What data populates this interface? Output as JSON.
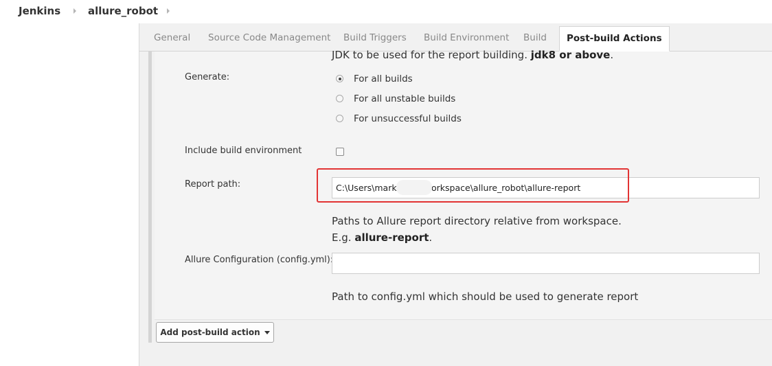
{
  "breadcrumb": {
    "items": [
      "Jenkins",
      "allure_robot"
    ]
  },
  "tabs": [
    {
      "label": "General",
      "active": false
    },
    {
      "label": "Source Code Management",
      "active": false
    },
    {
      "label": "Build Triggers",
      "active": false
    },
    {
      "label": "Build Environment",
      "active": false
    },
    {
      "label": "Build",
      "active": false
    },
    {
      "label": "Post-build Actions",
      "active": true
    }
  ],
  "form": {
    "jdk_help_prefix": "JDK to be used for the report building.",
    "jdk_help_bold": "jdk8 or above",
    "jdk_help_suffix": ".",
    "generate_label": "Generate:",
    "generate_options": [
      {
        "label": "For all builds",
        "checked": true
      },
      {
        "label": "For all unstable builds",
        "checked": false
      },
      {
        "label": "For unsuccessful builds",
        "checked": false
      }
    ],
    "include_env_label": "Include build environment",
    "include_env_checked": false,
    "report_path_label": "Report path:",
    "report_path_value": "C:\\Users\\mark\\        \\workspace\\allure_robot\\allure-report",
    "report_path_help_line1": "Paths to Allure report directory relative from workspace.",
    "report_path_help_prefix": "E.g.",
    "report_path_help_bold": "allure-report",
    "report_path_help_suffix": ".",
    "config_label": "Allure Configuration (config.yml):",
    "config_value": "",
    "config_help": "Path to config.yml which should be used to generate report"
  },
  "add_action_button": "Add post-build action",
  "colors": {
    "highlight": "#e23333",
    "background": "#f1f1f1"
  }
}
